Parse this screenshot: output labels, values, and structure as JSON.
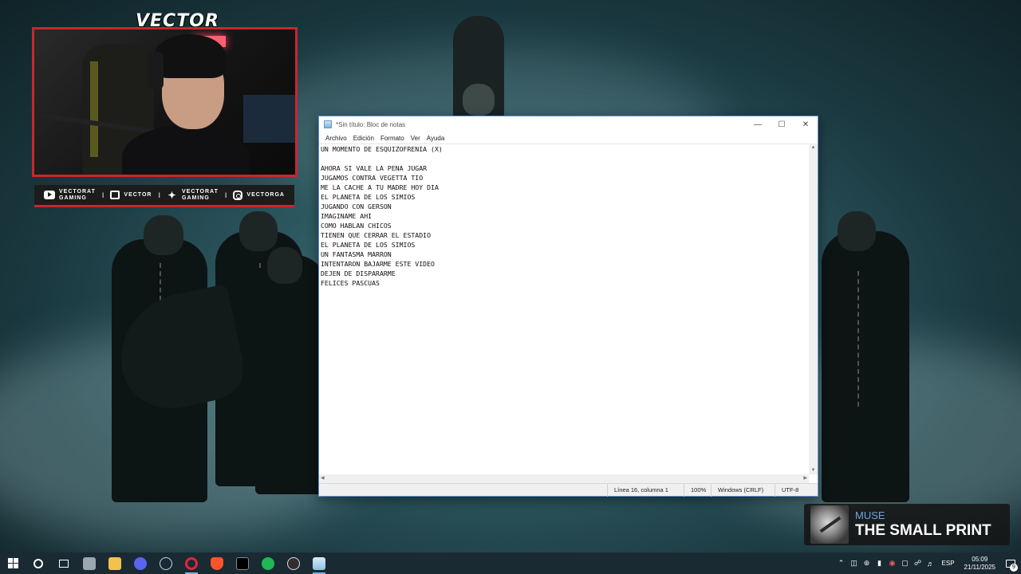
{
  "overlay": {
    "brand": "VECTOR",
    "socials": [
      {
        "icon": "youtube-icon",
        "line1": "VECTORAT",
        "line2": "GAMING"
      },
      {
        "icon": "twitch-icon",
        "line1": "VECTOR",
        "line2": ""
      },
      {
        "icon": "twitter-icon",
        "line1": "VECTORAT",
        "line2": "GAMING"
      },
      {
        "icon": "instagram-icon",
        "line1": "VECTORGA",
        "line2": ""
      }
    ],
    "separator": "I"
  },
  "notepad": {
    "title": "*Sin título: Bloc de notas",
    "menu": [
      "Archivo",
      "Edición",
      "Formato",
      "Ver",
      "Ayuda"
    ],
    "lines": [
      "UN MOMENTO DE ESQUIZOFRENIA (X)",
      "",
      "AHORA SI VALE LA PENA JUGAR",
      "JUGAMOS CONTRA VEGETTA TIO",
      "ME LA CACHE A TU MADRE HOY DIA",
      "EL PLANETA DE LOS SIMIOS",
      "JUGANDO CON GERSON",
      "IMAGINAME AHI",
      "COMO HABLAN CHICOS",
      "TIENEN QUE CERRAR EL ESTADIO",
      "EL PLANETA DE LOS SIMIOS",
      "UN FANTASMA MARRON",
      "INTENTARON BAJARME ESTE VIDEO",
      "DEJEN DE DISPARARME",
      "FELICES PASCUAS"
    ],
    "status": {
      "position": "Línea 16, columna 1",
      "zoom": "100%",
      "line_ending": "Windows (CRLF)",
      "encoding": "UTF-8"
    }
  },
  "now_playing": {
    "artist": "MUSE",
    "track": "THE SMALL PRINT"
  },
  "taskbar": {
    "apps": [
      "start-icon",
      "search-icon",
      "task-view-icon",
      "file-manager-icon",
      "folder-icon",
      "discord-icon",
      "steam-icon",
      "opera-icon",
      "brave-icon",
      "game-icon",
      "spotify-icon",
      "obs-icon",
      "notepad-icon"
    ],
    "tray": {
      "language": "ESP",
      "time": "05:09",
      "date": "21/11/2025",
      "notifications": "9"
    }
  }
}
